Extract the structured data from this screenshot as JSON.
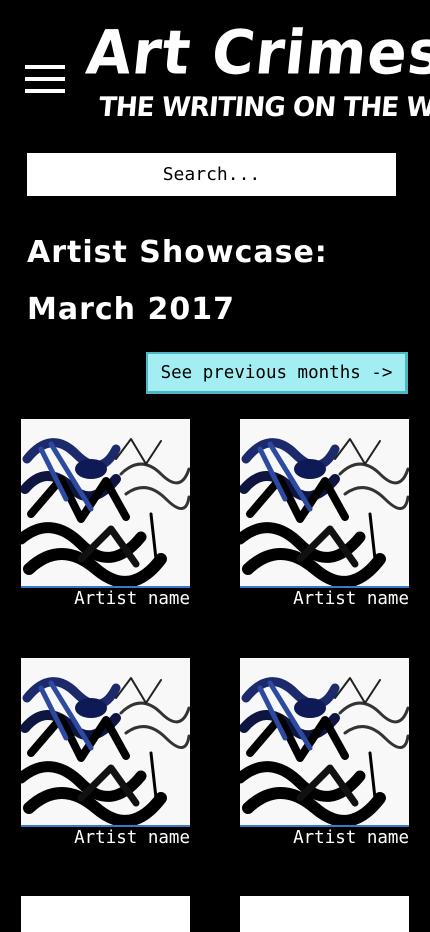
{
  "header": {
    "title": "Art Crimes",
    "tagline": "THE WRITING ON THE WALL",
    "menu_icon": "hamburger-menu-icon"
  },
  "search": {
    "placeholder": "Search..."
  },
  "showcase": {
    "title_line1": "Artist Showcase:",
    "title_line2": "March 2017",
    "prev_button_label": "See previous months ->"
  },
  "artists": [
    {
      "name": "Artist name"
    },
    {
      "name": "Artist name"
    },
    {
      "name": "Artist name"
    },
    {
      "name": "Artist name"
    },
    {
      "name": "",
      "partial": true
    },
    {
      "name": "",
      "partial": true
    }
  ]
}
